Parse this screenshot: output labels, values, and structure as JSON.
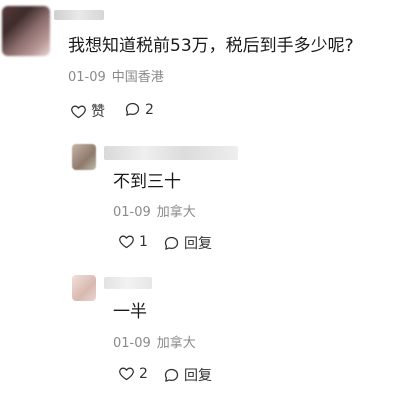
{
  "main_comment": {
    "text": "我想知道税前53万，税后到手多少呢?",
    "date": "01-09",
    "location": "中国香港",
    "like_label": "赞",
    "reply_count": "2"
  },
  "replies": [
    {
      "text": "不到三十",
      "date": "01-09",
      "location": "加拿大",
      "like_count": "1",
      "reply_label": "回复"
    },
    {
      "text": "一半",
      "date": "01-09",
      "location": "加拿大",
      "like_count": "2",
      "reply_label": "回复"
    }
  ],
  "icons": {
    "like": "heart-icon",
    "comment": "comment-bubble-icon"
  },
  "colors": {
    "text": "#1a1a1a",
    "meta": "#8a8a8a",
    "icon": "#333333"
  }
}
